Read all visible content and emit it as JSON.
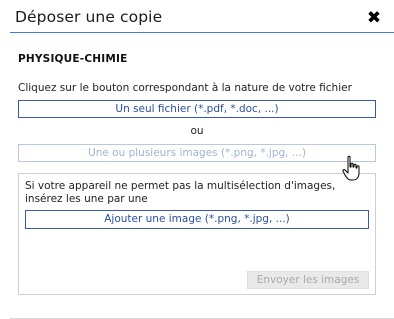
{
  "dialog": {
    "title": "Déposer une copie",
    "close_icon": "close-icon"
  },
  "section": {
    "title": "PHYSIQUE-CHIMIE",
    "instruction": "Cliquez sur le bouton correspondant à la nature de votre fichier"
  },
  "buttons": {
    "single_file": "Un seul fichier (*.pdf, *.doc, ...)",
    "or": "ou",
    "multi_images": "Une ou plusieurs images (*.png, *.jpg, ...)"
  },
  "panel": {
    "text": "Si votre appareil ne permet pas la multisélection d'images, insérez les une par une",
    "add_image": "Ajouter une image (*.png, *.jpg, ...)",
    "send_images": "Envoyer les images"
  },
  "colors": {
    "accent": "#3a7bd5",
    "button_border": "#3a5aa8",
    "button_text": "#2a4fa0",
    "disabled_bg": "#e9e9e9"
  },
  "cursor": {
    "icon": "hand-pointer-icon"
  }
}
